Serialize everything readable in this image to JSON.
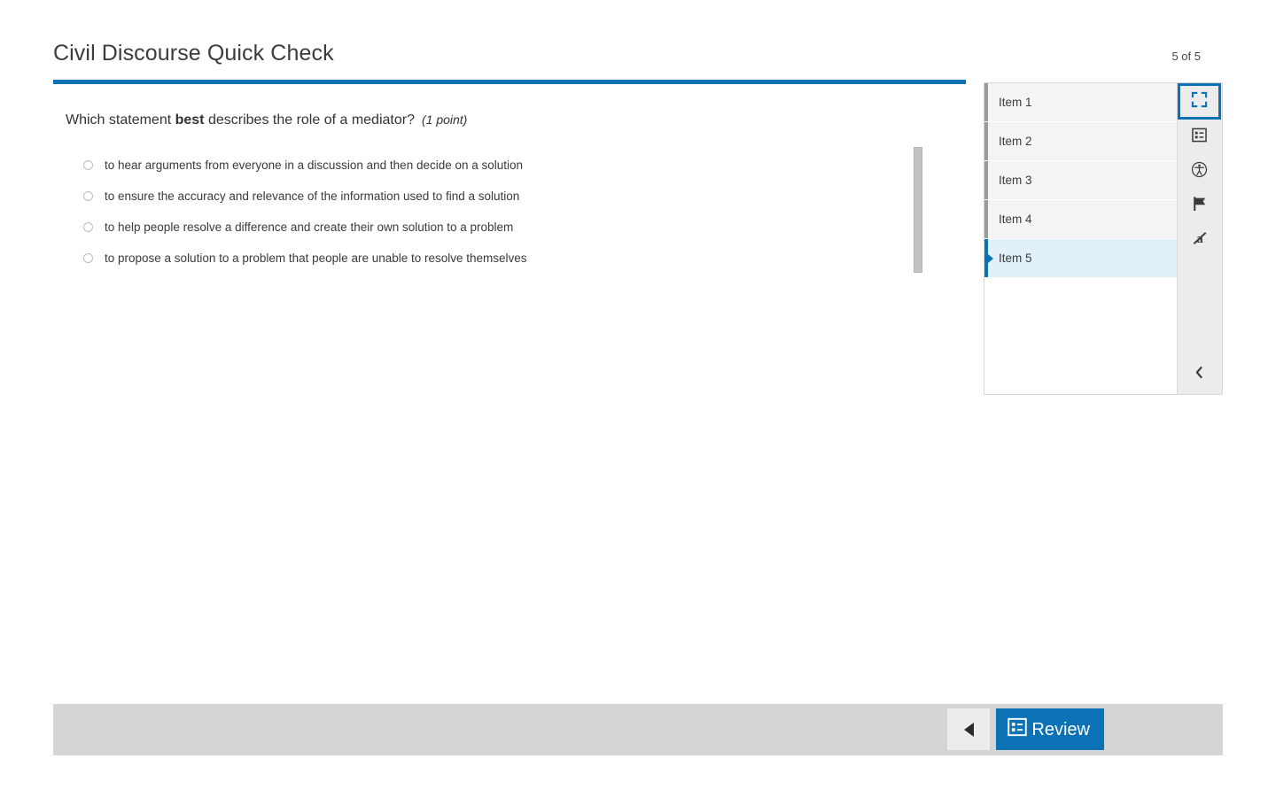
{
  "header": {
    "title": "Civil Discourse Quick Check",
    "counter": "5 of 5",
    "accent_color": "#0a72b5"
  },
  "question": {
    "stem_prefix": "Which statement ",
    "stem_emphasis": "best",
    "stem_suffix": " describes the role of a mediator?",
    "points": "(1 point)",
    "options": [
      {
        "label": "to hear arguments from everyone in a discussion and then decide on a solution",
        "selected": false
      },
      {
        "label": "to ensure the accuracy and relevance of the information used to find a solution",
        "selected": false
      },
      {
        "label": "to help people resolve a difference and create their own solution to a problem",
        "selected": false
      },
      {
        "label": "to propose a solution to a problem that people are unable to resolve themselves",
        "selected": false
      }
    ]
  },
  "item_panel": {
    "items": [
      {
        "label": "Item 1",
        "active": false
      },
      {
        "label": "Item 2",
        "active": false
      },
      {
        "label": "Item 3",
        "active": false
      },
      {
        "label": "Item 4",
        "active": false
      },
      {
        "label": "Item 5",
        "active": true
      }
    ],
    "tools": [
      {
        "icon": "fullscreen-icon",
        "active": true
      },
      {
        "icon": "item-list-icon",
        "active": false
      },
      {
        "icon": "accessibility-icon",
        "active": false
      },
      {
        "icon": "flag-icon",
        "active": false
      },
      {
        "icon": "answer-eliminator-icon",
        "active": false
      }
    ],
    "collapse_icon": "chevron-left-icon",
    "active_tool_color": "#0a72b5",
    "active_item_color": "#e2f0fa"
  },
  "footer": {
    "previous_icon": "triangle-left-icon",
    "review_icon": "item-list-icon",
    "review_label": "Review",
    "review_color": "#0a72b5"
  }
}
